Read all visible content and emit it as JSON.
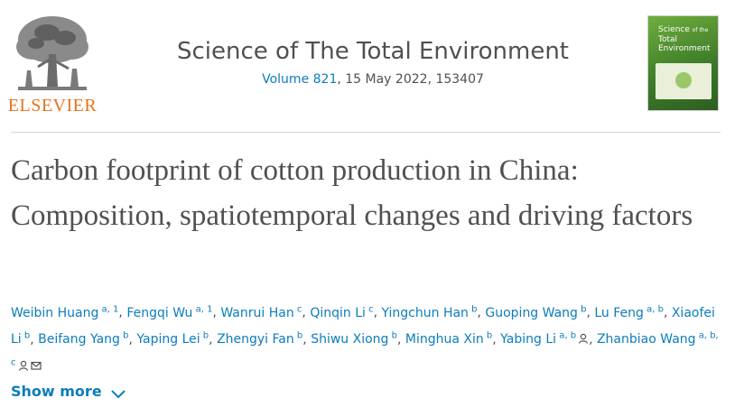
{
  "publisher": {
    "wordmark": "ELSEVIER"
  },
  "journal": {
    "title": "Science of The Total Environment",
    "volume_link": "Volume 821",
    "issue_info": ", 15 May 2022, 153407"
  },
  "cover": {
    "line1": "Science",
    "line1_small": "of the",
    "line2": "Total Environment"
  },
  "article": {
    "title": "Carbon footprint of cotton production in China: Composition, spatiotemporal changes and driving factors"
  },
  "authors": [
    {
      "name": "Weibin Huang",
      "aff": "a, 1"
    },
    {
      "name": "Fengqi Wu",
      "aff": "a, 1"
    },
    {
      "name": "Wanrui Han",
      "aff": "c"
    },
    {
      "name": "Qinqin Li",
      "aff": "c"
    },
    {
      "name": "Yingchun Han",
      "aff": "b"
    },
    {
      "name": "Guoping Wang",
      "aff": "b"
    },
    {
      "name": "Lu Feng",
      "aff": "a, b"
    },
    {
      "name": "Xiaofei Li",
      "aff": "b"
    },
    {
      "name": "Beifang Yang",
      "aff": "b"
    },
    {
      "name": "Yaping Lei",
      "aff": "b"
    },
    {
      "name": "Zhengyi Fan",
      "aff": "b"
    },
    {
      "name": "Shiwu Xiong",
      "aff": "b"
    },
    {
      "name": "Minghua Xin",
      "aff": "b"
    },
    {
      "name": "Yabing Li",
      "aff": "a, b",
      "icons": [
        "person-icon"
      ]
    },
    {
      "name": "Zhanbiao Wang",
      "aff": "a, b, c",
      "icons": [
        "person-icon",
        "envelope-icon"
      ]
    }
  ],
  "show_more": {
    "label": "Show more",
    "icon": "chevron-down-icon"
  },
  "colors": {
    "link": "#0c7dbb",
    "publisher_orange": "#e9711c",
    "text": "#505050"
  }
}
